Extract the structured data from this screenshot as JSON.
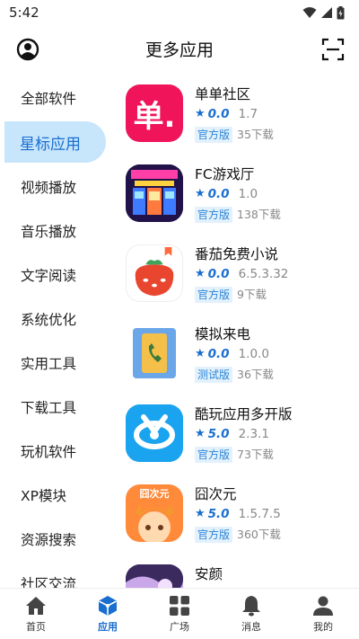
{
  "status_bar": {
    "time": "5:42"
  },
  "header": {
    "title": "更多应用"
  },
  "sidebar": {
    "items": [
      {
        "label": "全部软件"
      },
      {
        "label": "星标应用",
        "active": true
      },
      {
        "label": "视频播放"
      },
      {
        "label": "音乐播放"
      },
      {
        "label": "文字阅读"
      },
      {
        "label": "系统优化"
      },
      {
        "label": "实用工具"
      },
      {
        "label": "下载工具"
      },
      {
        "label": "玩机软件"
      },
      {
        "label": "XP模块"
      },
      {
        "label": "资源搜索"
      },
      {
        "label": "社区交流"
      }
    ]
  },
  "apps": [
    {
      "name": "单单社区",
      "rating": "0.0",
      "version": "1.7",
      "badge": "官方版",
      "downloads": "35下载",
      "icon": "dandan-logo-icon",
      "icon_text": "单."
    },
    {
      "name": "FC游戏厅",
      "rating": "0.0",
      "version": "1.0",
      "badge": "官方版",
      "downloads": "138下载",
      "icon": "arcade-room-icon"
    },
    {
      "name": "番茄免费小说",
      "rating": "0.0",
      "version": "6.5.3.32",
      "badge": "官方版",
      "downloads": "9下载",
      "icon": "tomato-novel-icon"
    },
    {
      "name": "模拟来电",
      "rating": "0.0",
      "version": "1.0.0",
      "badge": "测试版",
      "downloads": "36下载",
      "icon": "phone-call-icon"
    },
    {
      "name": "酷玩应用多开版",
      "rating": "5.0",
      "version": "2.3.1",
      "badge": "官方版",
      "downloads": "73下载",
      "icon": "kuwan-logo-icon"
    },
    {
      "name": "囧次元",
      "rating": "5.0",
      "version": "1.5.7.5",
      "badge": "官方版",
      "downloads": "360下载",
      "icon": "jiong-ciyuan-icon",
      "icon_text": "囧次元"
    },
    {
      "name": "安颜",
      "rating": "",
      "version": "",
      "badge": "",
      "downloads": "",
      "icon": "anyan-icon"
    }
  ],
  "bottom_nav": [
    {
      "label": "首页",
      "icon": "home-icon"
    },
    {
      "label": "应用",
      "icon": "cube-icon",
      "active": true
    },
    {
      "label": "广场",
      "icon": "grid-icon"
    },
    {
      "label": "消息",
      "icon": "bell-icon"
    },
    {
      "label": "我的",
      "icon": "user-icon"
    }
  ],
  "colors": {
    "accent": "#1a6ecf",
    "active_bg": "#c7e5fb",
    "badge_bg": "#e3f1fc"
  }
}
